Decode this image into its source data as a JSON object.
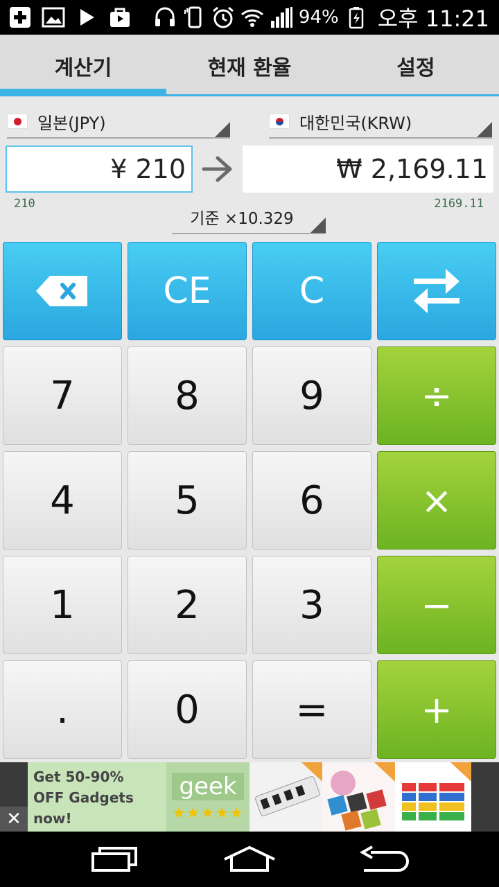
{
  "status_bar": {
    "battery_pct": "94%",
    "time": "오후 11:21",
    "icons_left": [
      "add-icon",
      "image-icon",
      "play-icon",
      "bag-icon"
    ],
    "icons_right": [
      "headset-icon",
      "vibrate-icon",
      "alarm-icon",
      "wifi-icon",
      "signal-icon",
      "battery-icon"
    ]
  },
  "tabs": [
    {
      "label": "계산기",
      "active": true
    },
    {
      "label": "현재 환율",
      "active": false
    },
    {
      "label": "설정",
      "active": false
    }
  ],
  "converter": {
    "from_currency": "일본(JPY)",
    "to_currency": "대한민국(KRW)",
    "from_amount": "¥ 210",
    "to_amount": "₩ 2,169.11",
    "from_raw": "210",
    "to_raw": "2169.11",
    "rate_label": "기준 ×10.329"
  },
  "keypad": {
    "row1": [
      "backspace-icon",
      "CE",
      "C",
      "swap-icon"
    ],
    "row2": [
      "7",
      "8",
      "9",
      "÷"
    ],
    "row3": [
      "4",
      "5",
      "6",
      "×"
    ],
    "row4": [
      "1",
      "2",
      "3",
      "−"
    ],
    "row5": [
      ".",
      "0",
      "=",
      "+"
    ]
  },
  "ad": {
    "line1": "Get 50-90%",
    "line2": "OFF Gadgets",
    "line3": "now!",
    "logo": "geek",
    "stars": "★★★★★",
    "close": "✕"
  },
  "colors": {
    "accent_blue": "#3db4e5",
    "key_green": "#6cb322",
    "arrow_gray": "#6b6b6b"
  }
}
